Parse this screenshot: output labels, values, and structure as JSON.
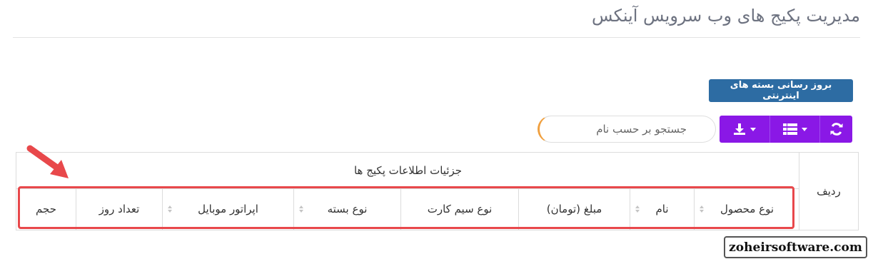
{
  "page": {
    "title": "مدیریت پکیج های وب سرویس آینکس"
  },
  "toolbar": {
    "update_label": "بروز رسانی بسته های اینترنتی",
    "refresh_icon": "refresh-icon",
    "columns_icon": "columns-grid-icon",
    "download_icon": "download-icon",
    "accent_color": "#8a18e6",
    "update_color": "#2d6ca3"
  },
  "search": {
    "placeholder": "جستجو بر حسب نام",
    "value": ""
  },
  "table": {
    "row_number_header": "ردیف",
    "group_header": "جزئیات اطلاعات پکیج ها",
    "columns": [
      {
        "label": "نوع محصول",
        "sortable": true
      },
      {
        "label": "نام",
        "sortable": true
      },
      {
        "label": "مبلغ (تومان)",
        "sortable": false
      },
      {
        "label": "نوع سیم کارت",
        "sortable": false
      },
      {
        "label": "نوع بسته",
        "sortable": true
      },
      {
        "label": "اپراتور موبایل",
        "sortable": true
      },
      {
        "label": "تعداد روز",
        "sortable": false
      },
      {
        "label": "حجم",
        "sortable": false
      }
    ]
  },
  "annotation": {
    "highlight_color": "#e8484b"
  },
  "watermark": {
    "text": "zoheirsoftware.com"
  }
}
